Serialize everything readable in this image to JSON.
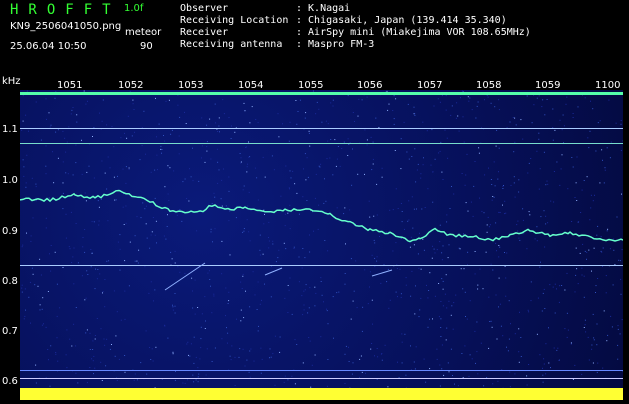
{
  "header": {
    "logo": "HROFFT",
    "version": "1.0f",
    "filename": "KN9_2506041050.png",
    "datetime": "25.06.04 10:50",
    "mode_label": "meteor",
    "mode_value": "90"
  },
  "info": [
    {
      "label": "Observer",
      "value": ": K.Nagai"
    },
    {
      "label": "Receiving Location",
      "value": ": Chigasaki, Japan (139.414 35.340)"
    },
    {
      "label": "Receiver",
      "value": ": AirSpy mini (Miakejima VOR 108.65MHz)"
    },
    {
      "label": "Receiving antenna",
      "value": ": Maspro FM-3"
    }
  ],
  "plot": {
    "y_unit": "kHz",
    "y_ticks": [
      "1.1",
      "1.0",
      "0.9",
      "0.8",
      "0.7",
      "0.6"
    ],
    "x_ticks": [
      "1051",
      "1052",
      "1053",
      "1054",
      "1055",
      "1056",
      "1057",
      "1058",
      "1059",
      "1100"
    ],
    "colors": {
      "background": "#06105a",
      "signal": "#66ffcc",
      "bottom_band": "#ffff33",
      "lines": "#aaccff"
    }
  }
}
